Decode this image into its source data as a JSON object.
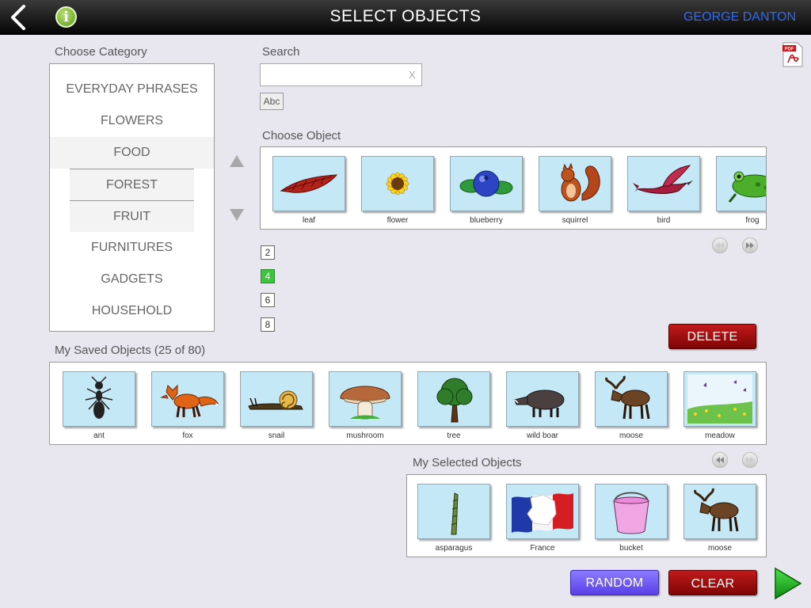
{
  "header": {
    "title": "SELECT OBJECTS",
    "user": "GEORGE DANTON",
    "info_glyph": "i"
  },
  "category": {
    "label": "Choose Category",
    "items": [
      {
        "label": "EVERYDAY PHRASES"
      },
      {
        "label": "FLOWERS"
      },
      {
        "label": "FOOD"
      },
      {
        "label": "FOREST"
      },
      {
        "label": "FRUIT"
      },
      {
        "label": "FURNITURES"
      },
      {
        "label": "GADGETS"
      },
      {
        "label": "HOUSEHOLD"
      }
    ]
  },
  "search": {
    "label": "Search",
    "value": "",
    "placeholder": "",
    "clear_label": "X",
    "abc_label": "Abc"
  },
  "choose_object": {
    "label": "Choose Object",
    "items": [
      {
        "label": "leaf",
        "icon": "leaf-icon"
      },
      {
        "label": "flower",
        "icon": "sunflower-icon"
      },
      {
        "label": "blueberry",
        "icon": "blueberry-icon"
      },
      {
        "label": "squirrel",
        "icon": "squirrel-icon"
      },
      {
        "label": "bird",
        "icon": "bird-icon"
      },
      {
        "label": "frog",
        "icon": "frog-icon"
      }
    ]
  },
  "page_sizes": {
    "options": [
      "2",
      "4",
      "6",
      "8"
    ],
    "selected": "4",
    "active_color": "#3ec43e"
  },
  "delete_label": "DELETE",
  "saved": {
    "label": "My Saved Objects (25 of 80)",
    "items": [
      {
        "label": "ant",
        "icon": "ant-icon"
      },
      {
        "label": "fox",
        "icon": "fox-icon"
      },
      {
        "label": "snail",
        "icon": "snail-icon"
      },
      {
        "label": "mushroom",
        "icon": "mushroom-icon"
      },
      {
        "label": "tree",
        "icon": "tree-icon"
      },
      {
        "label": "wild boar",
        "icon": "boar-icon"
      },
      {
        "label": "moose",
        "icon": "moose-icon"
      },
      {
        "label": "meadow",
        "icon": "meadow-icon"
      }
    ]
  },
  "selected": {
    "label": "My Selected Objects",
    "items": [
      {
        "label": "asparagus",
        "icon": "asparagus-icon"
      },
      {
        "label": "France",
        "icon": "france-map-icon"
      },
      {
        "label": "bucket",
        "icon": "bucket-icon"
      },
      {
        "label": "moose",
        "icon": "moose-icon"
      }
    ]
  },
  "actions": {
    "random_label": "RANDOM",
    "clear_label": "CLEAR"
  },
  "colors": {
    "accent_user": "#2f6cf2",
    "delete_red": "#a00d0d",
    "random_purple": "#6f5cf5",
    "next_green": "#1fb51f",
    "tile_bg": "#c4e8f6"
  }
}
